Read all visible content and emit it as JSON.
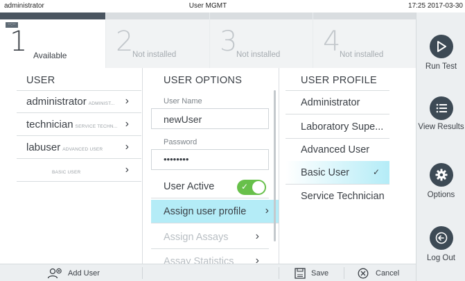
{
  "status": {
    "user": "administrator",
    "title": "User MGMT",
    "time": "17:25 2017-03-30"
  },
  "tabs": [
    {
      "num": "1",
      "label": "Available",
      "dash": "--:--"
    },
    {
      "num": "2",
      "label": "Not installed"
    },
    {
      "num": "3",
      "label": "Not installed"
    },
    {
      "num": "4",
      "label": "Not installed"
    }
  ],
  "columns": {
    "user": "USER",
    "options": "USER OPTIONS",
    "profile": "USER PROFILE"
  },
  "users": [
    {
      "name": "administrator",
      "role": "ADMINIST..."
    },
    {
      "name": "technician",
      "role": "SERVICE TECHN..."
    },
    {
      "name": "labuser",
      "role": "ADVANCED USER"
    },
    {
      "name": "",
      "role": "BASIC USER"
    }
  ],
  "options": {
    "username_label": "User Name",
    "username_value": "newUser",
    "password_label": "Password",
    "password_value": "••••••••",
    "active_label": "User Active",
    "active_on": true,
    "assign_profile": "Assign user profile",
    "assign_assays": "Assign Assays",
    "assay_statistics": "Assay Statistics"
  },
  "profiles": [
    {
      "label": "Administrator",
      "selected": false
    },
    {
      "label": "Laboratory Supe...",
      "selected": false
    },
    {
      "label": "Advanced User",
      "selected": false
    },
    {
      "label": "Basic User",
      "selected": true
    },
    {
      "label": "Service Technician",
      "selected": false
    }
  ],
  "sidebar": {
    "run": "Run Test",
    "view": "View Results",
    "options": "Options",
    "logout": "Log Out"
  },
  "bottom": {
    "add_user": "Add User",
    "save": "Save",
    "cancel": "Cancel"
  },
  "colors": {
    "accent_selected": "#b4ecf7",
    "toggle_on": "#67c04a",
    "sidebar_button": "#3d4a55"
  }
}
